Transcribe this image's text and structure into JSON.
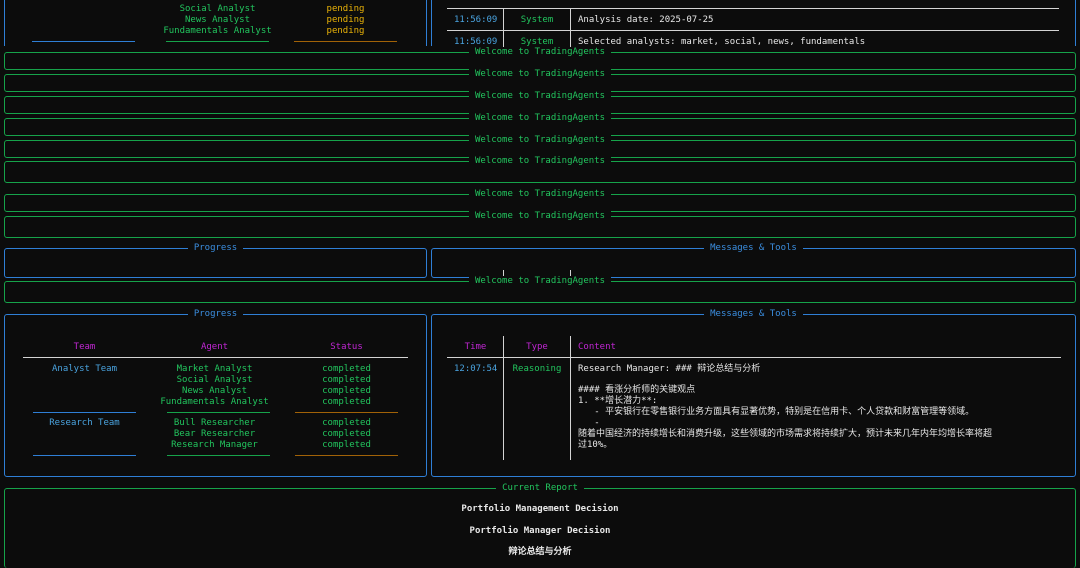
{
  "welcome_title": "Welcome to TradingAgents",
  "top_progress": {
    "agents": [
      "Social Analyst",
      "News Analyst",
      "Fundamentals Analyst"
    ],
    "statuses": [
      "pending",
      "pending",
      "pending"
    ]
  },
  "top_messages": [
    {
      "time": "11:56:09",
      "type": "System",
      "content": "Analysis date: 2025-07-25"
    },
    {
      "time": "11:56:09",
      "type": "System",
      "content": "Selected analysts: market, social, news, fundamentals"
    }
  ],
  "progress_title": "Progress",
  "messages_title": "Messages & Tools",
  "progress_table": {
    "headers": {
      "team": "Team",
      "agent": "Agent",
      "status": "Status"
    },
    "groups": [
      {
        "team": "Analyst Team",
        "agents": [
          "Market Analyst",
          "Social Analyst",
          "News Analyst",
          "Fundamentals Analyst"
        ],
        "statuses": [
          "completed",
          "completed",
          "completed",
          "completed"
        ]
      },
      {
        "team": "Research Team",
        "agents": [
          "Bull Researcher",
          "Bear Researcher",
          "Research Manager"
        ],
        "statuses": [
          "completed",
          "completed",
          "completed"
        ]
      }
    ]
  },
  "messages_table": {
    "headers": {
      "time": "Time",
      "type": "Type",
      "content": "Content"
    },
    "message": {
      "time": "12:07:54",
      "type": "Reasoning",
      "lines": [
        "Research Manager: ### 辩论总结与分析",
        "",
        "#### 看涨分析师的关键观点",
        "1. **增长潜力**:",
        "   - 平安银行在零售银行业务方面具有显著优势，特别是在信用卡、个人贷款和财富管理等领域。",
        "   -",
        "随着中国经济的持续增长和消费升级，这些领域的市场需求将持续扩大，预计未来几年内年均增长率将超",
        "过10%。"
      ]
    }
  },
  "current_report": {
    "title": "Current Report",
    "lines": [
      "Portfolio Management Decision",
      "Portfolio Manager Decision",
      "辩论总结与分析"
    ]
  }
}
